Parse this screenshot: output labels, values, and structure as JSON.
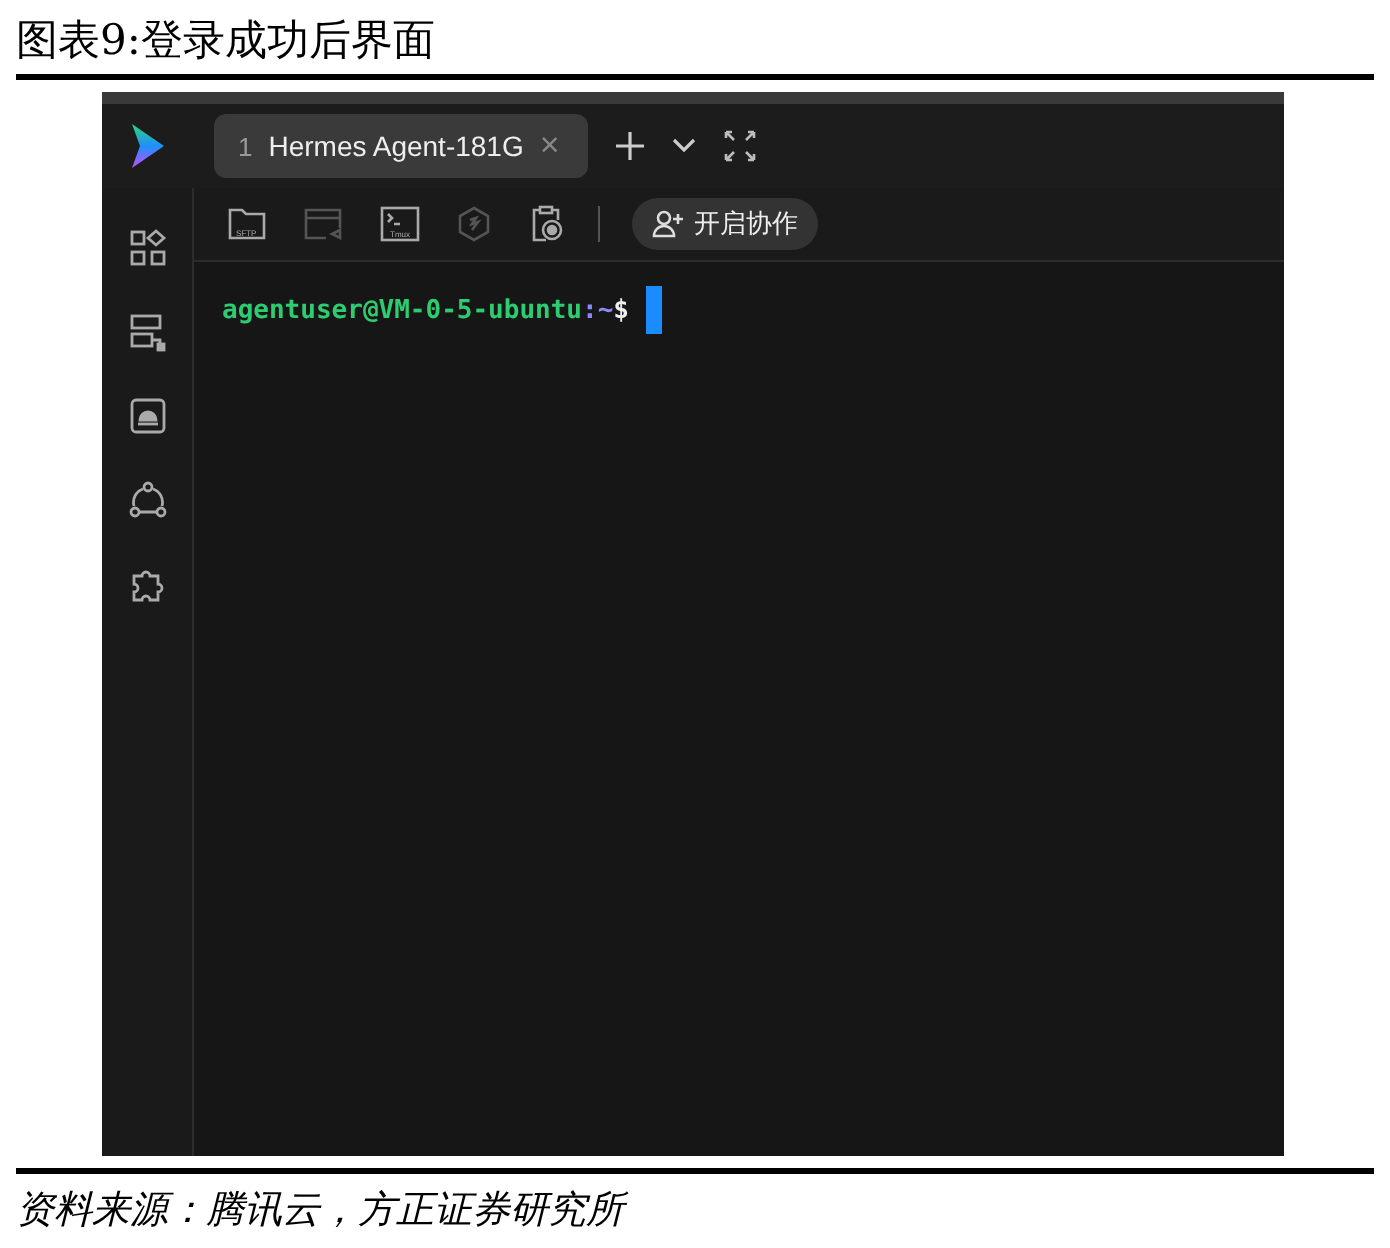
{
  "figure_title": "图表9:登录成功后界面",
  "app": {
    "tab": {
      "number": "1",
      "label": "Hermes Agent-181G",
      "close": "×",
      "selected": true
    },
    "rail": [
      {
        "kind": "apps"
      },
      {
        "kind": "servers"
      },
      {
        "kind": "cloud"
      },
      {
        "kind": "share"
      },
      {
        "kind": "plugin"
      }
    ],
    "tools": [
      {
        "kind": "folder",
        "caption": "SFTP",
        "disabled": false
      },
      {
        "kind": "window",
        "disabled": true
      },
      {
        "kind": "terminal",
        "caption": "Tmux",
        "disabled": false
      },
      {
        "kind": "hexagon",
        "disabled": true
      },
      {
        "kind": "clipboard",
        "disabled": false
      }
    ],
    "collab_button": "开启协作",
    "terminal": {
      "user_host": "agentuser@VM-0-5-ubuntu",
      "path": ":~",
      "prompt": "$"
    }
  },
  "source": "资料来源：腾讯云，方正证券研究所"
}
